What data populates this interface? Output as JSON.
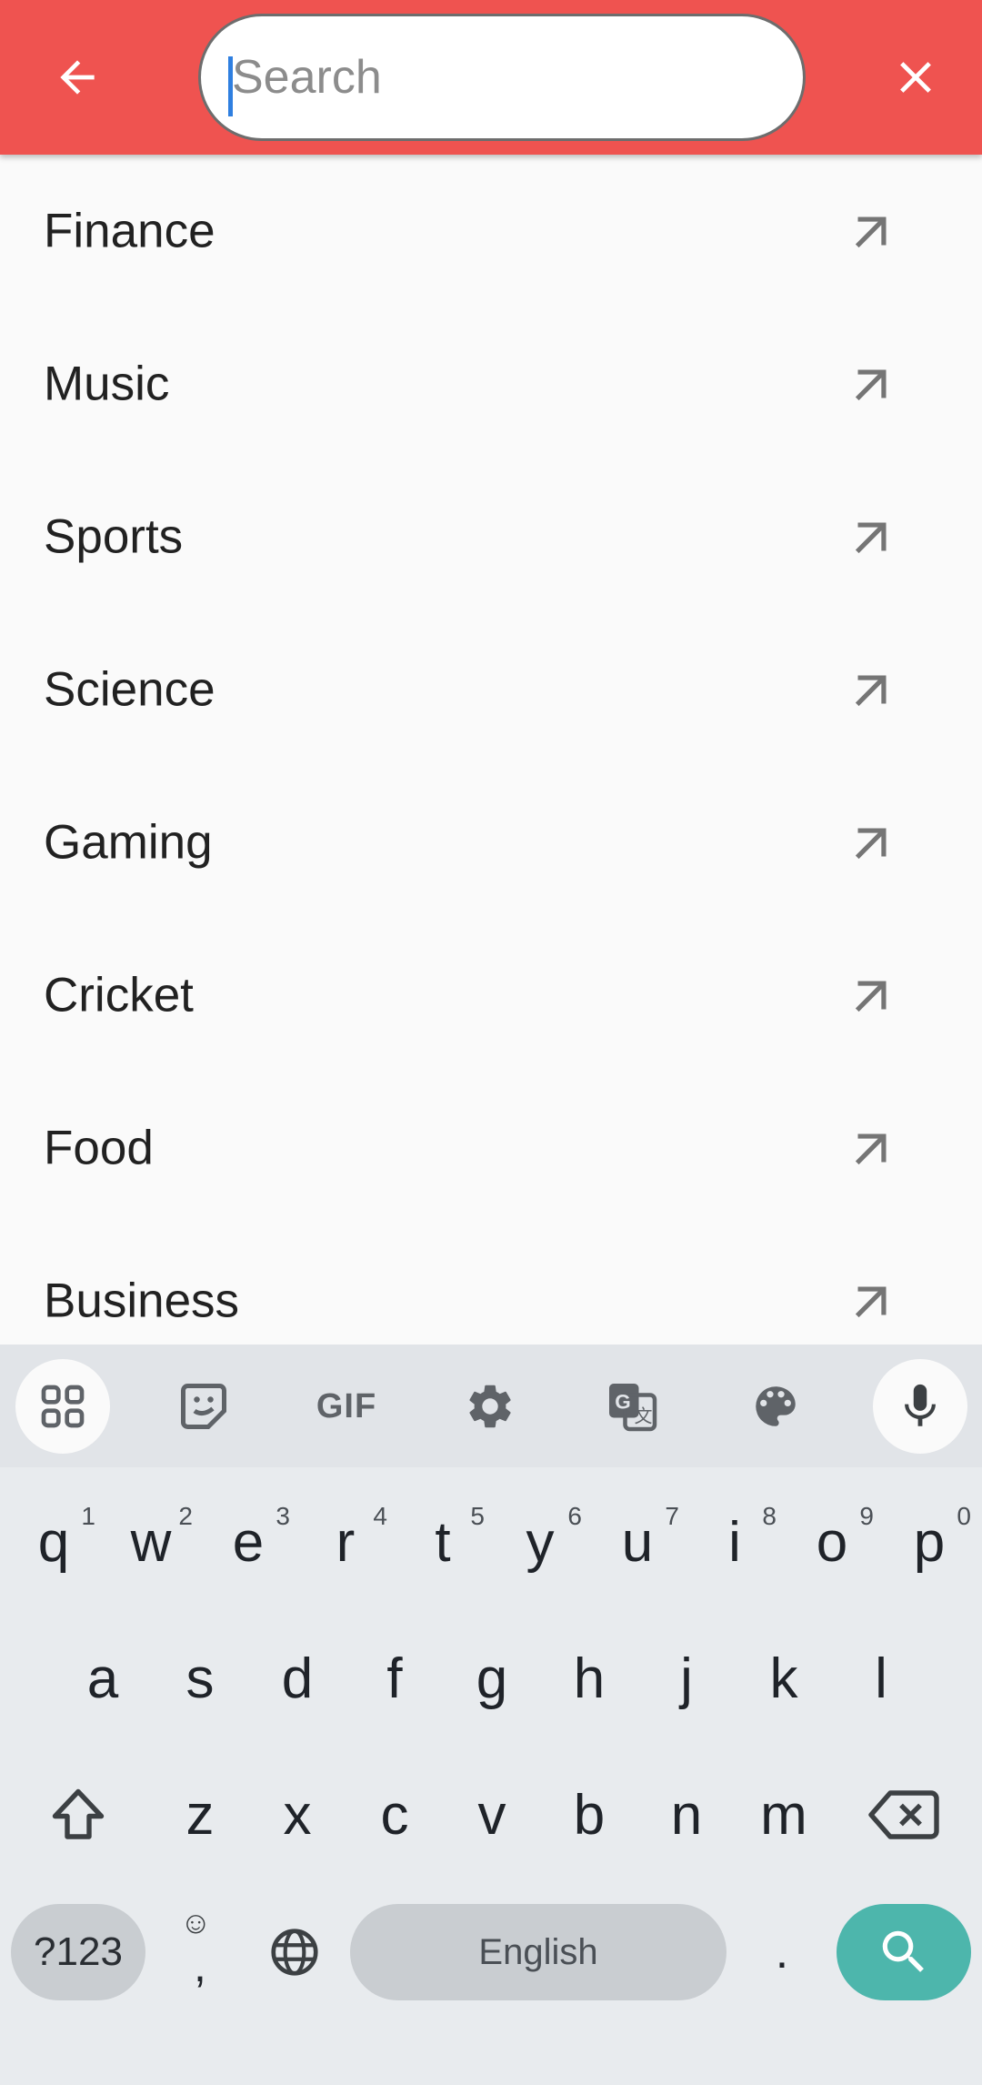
{
  "search": {
    "placeholder": "Search",
    "value": ""
  },
  "icons": {
    "back": "arrow-left-icon",
    "close": "close-icon",
    "suggestion_arrow": "arrow-up-left-icon"
  },
  "colors": {
    "appbar": "#ef5350",
    "enter_key": "#4db6ac",
    "caret": "#2f7fe0"
  },
  "suggestions": [
    {
      "label": "Finance"
    },
    {
      "label": "Music"
    },
    {
      "label": "Sports"
    },
    {
      "label": "Science"
    },
    {
      "label": "Gaming"
    },
    {
      "label": "Cricket"
    },
    {
      "label": "Food"
    },
    {
      "label": "Business"
    }
  ],
  "keyboard": {
    "toolbar": {
      "gif_label": "GIF"
    },
    "row1": [
      {
        "key": "q",
        "hint": "1"
      },
      {
        "key": "w",
        "hint": "2"
      },
      {
        "key": "e",
        "hint": "3"
      },
      {
        "key": "r",
        "hint": "4"
      },
      {
        "key": "t",
        "hint": "5"
      },
      {
        "key": "y",
        "hint": "6"
      },
      {
        "key": "u",
        "hint": "7"
      },
      {
        "key": "i",
        "hint": "8"
      },
      {
        "key": "o",
        "hint": "9"
      },
      {
        "key": "p",
        "hint": "0"
      }
    ],
    "row2": [
      "a",
      "s",
      "d",
      "f",
      "g",
      "h",
      "j",
      "k",
      "l"
    ],
    "row3": [
      "z",
      "x",
      "c",
      "v",
      "b",
      "n",
      "m"
    ],
    "symbols_label": "?123",
    "comma_label": ",",
    "space_label": "English",
    "period_label": "."
  }
}
